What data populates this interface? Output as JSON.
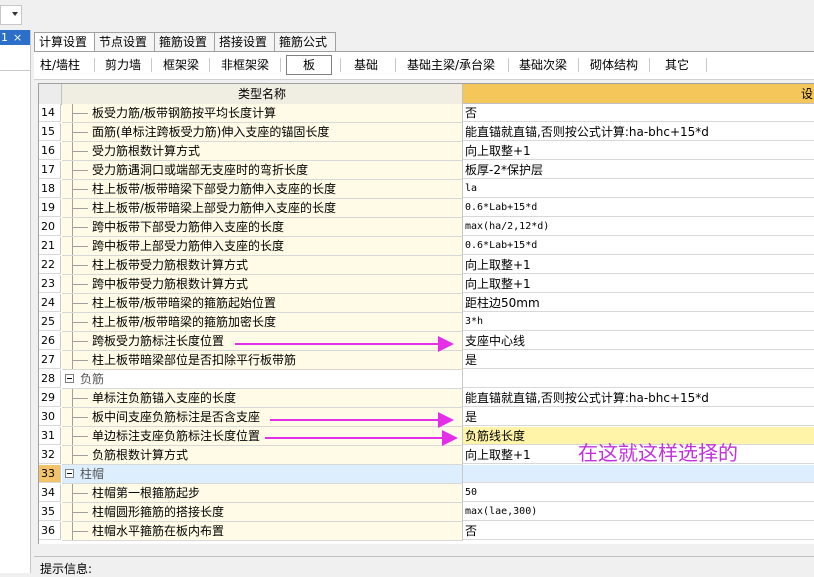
{
  "left_panel": {
    "tag_number": "1",
    "close": "×"
  },
  "tabs": [
    "计算设置",
    "节点设置",
    "箍筋设置",
    "搭接设置",
    "箍筋公式"
  ],
  "categories": [
    "柱/墙柱",
    "剪力墙",
    "框架梁",
    "非框架梁",
    "板",
    "基础",
    "基础主梁/承台梁",
    "基础次梁",
    "砌体结构",
    "其它"
  ],
  "selected_category": "板",
  "grid": {
    "header_name": "类型名称",
    "header_value": "设",
    "rows": [
      {
        "no": "14",
        "name": "板受力筋/板带钢筋按平均长度计算",
        "value": "否"
      },
      {
        "no": "15",
        "name": "面筋(单标注跨板受力筋)伸入支座的锚固长度",
        "value": "能直锚就直锚,否则按公式计算:ha-bhc+15*d"
      },
      {
        "no": "16",
        "name": "受力筋根数计算方式",
        "value": "向上取整+1"
      },
      {
        "no": "17",
        "name": "受力筋遇洞口或端部无支座时的弯折长度",
        "value": "板厚-2*保护层"
      },
      {
        "no": "18",
        "name": "柱上板带/板带暗梁下部受力筋伸入支座的长度",
        "value": "la"
      },
      {
        "no": "19",
        "name": "柱上板带/板带暗梁上部受力筋伸入支座的长度",
        "value": "0.6*Lab+15*d"
      },
      {
        "no": "20",
        "name": "跨中板带下部受力筋伸入支座的长度",
        "value": "max(ha/2,12*d)"
      },
      {
        "no": "21",
        "name": "跨中板带上部受力筋伸入支座的长度",
        "value": "0.6*Lab+15*d"
      },
      {
        "no": "22",
        "name": "柱上板带受力筋根数计算方式",
        "value": "向上取整+1"
      },
      {
        "no": "23",
        "name": "跨中板带受力筋根数计算方式",
        "value": "向上取整+1"
      },
      {
        "no": "24",
        "name": "柱上板带/板带暗梁的箍筋起始位置",
        "value": "距柱边50mm"
      },
      {
        "no": "25",
        "name": "柱上板带/板带暗梁的箍筋加密长度",
        "value": "3*h"
      },
      {
        "no": "26",
        "name": "跨板受力筋标注长度位置",
        "value": "支座中心线"
      },
      {
        "no": "27",
        "name": "柱上板带暗梁部位是否扣除平行板带筋",
        "value": "是"
      },
      {
        "no": "28",
        "name": "负筋",
        "value": "",
        "group": true
      },
      {
        "no": "29",
        "name": "单标注负筋锚入支座的长度",
        "value": "能直锚就直锚,否则按公式计算:ha-bhc+15*d"
      },
      {
        "no": "30",
        "name": "板中间支座负筋标注是否含支座",
        "value": "是"
      },
      {
        "no": "31",
        "name": "单边标注支座负筋标注长度位置",
        "value": "负筋线长度",
        "highlight": true
      },
      {
        "no": "32",
        "name": "负筋根数计算方式",
        "value": "向上取整+1"
      },
      {
        "no": "33",
        "name": "柱帽",
        "value": "",
        "group": true,
        "current": true
      },
      {
        "no": "34",
        "name": "柱帽第一根箍筋起步",
        "value": "50"
      },
      {
        "no": "35",
        "name": "柱帽圆形箍筋的搭接长度",
        "value": "max(lae,300)"
      },
      {
        "no": "36",
        "name": "柱帽水平箍筋在板内布置",
        "value": "否"
      }
    ]
  },
  "annotation": "在这就这样选择的",
  "annotation_color": "#c231dc",
  "hint_label": "提示信息:"
}
